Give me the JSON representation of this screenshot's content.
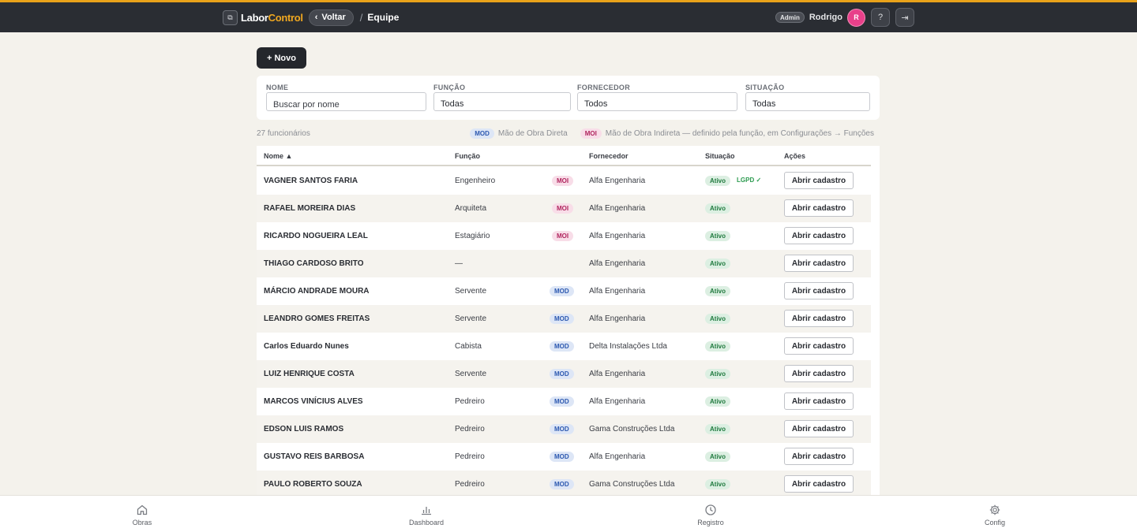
{
  "header": {
    "logo_glyph": "⧉",
    "brand_part1": "Labor",
    "brand_part2": "Control",
    "back_label": "Voltar",
    "back_icon": "‹",
    "separator": "/",
    "current_page": "Equipe",
    "role_badge": "Admin",
    "user_name": "Rodrigo",
    "avatar_initial": "R",
    "help_icon": "?",
    "logout_icon": "⇥"
  },
  "toolbar": {
    "new_label": "+ Novo"
  },
  "filters": {
    "name": {
      "label": "NOME",
      "placeholder": "Buscar por nome"
    },
    "function": {
      "label": "FUNÇÃO",
      "value": "Todas"
    },
    "supplier": {
      "label": "FORNECEDOR",
      "value": "Todos"
    },
    "status": {
      "label": "SITUAÇÃO",
      "value": "Todas"
    }
  },
  "summary": {
    "count": "27 funcionários",
    "mod_tag": "MOD",
    "mod_text": "Mão de Obra Direta",
    "moi_tag": "MOI",
    "moi_text": "Mão de Obra Indireta — definido pela função, em Configurações → Funções"
  },
  "table": {
    "columns": {
      "name": "Nome ▲",
      "function": "Função",
      "supplier": "Fornecedor",
      "status": "Situação",
      "actions": "Ações"
    },
    "action_label": "Abrir cadastro",
    "rows": [
      {
        "name": "VAGNER SANTOS FARIA",
        "function": "Engenheiro",
        "tag": "MOI",
        "supplier": "Alfa Engenharia",
        "status": "Ativo",
        "lgpd": "LGPD ✓"
      },
      {
        "name": "RAFAEL MOREIRA DIAS",
        "function": "Arquiteta",
        "tag": "MOI",
        "supplier": "Alfa Engenharia",
        "status": "Ativo",
        "lgpd": ""
      },
      {
        "name": "RICARDO NOGUEIRA LEAL",
        "function": "Estagiário",
        "tag": "MOI",
        "supplier": "Alfa Engenharia",
        "status": "Ativo",
        "lgpd": ""
      },
      {
        "name": "THIAGO CARDOSO BRITO",
        "function": "—",
        "tag": "",
        "supplier": "Alfa Engenharia",
        "status": "Ativo",
        "lgpd": ""
      },
      {
        "name": "MÁRCIO ANDRADE MOURA",
        "function": "Servente",
        "tag": "MOD",
        "supplier": "Alfa Engenharia",
        "status": "Ativo",
        "lgpd": ""
      },
      {
        "name": "LEANDRO GOMES FREITAS",
        "function": "Servente",
        "tag": "MOD",
        "supplier": "Alfa Engenharia",
        "status": "Ativo",
        "lgpd": ""
      },
      {
        "name": "Carlos Eduardo Nunes",
        "function": "Cabista",
        "tag": "MOD",
        "supplier": "Delta Instalações Ltda",
        "status": "Ativo",
        "lgpd": ""
      },
      {
        "name": "LUIZ HENRIQUE COSTA",
        "function": "Servente",
        "tag": "MOD",
        "supplier": "Alfa Engenharia",
        "status": "Ativo",
        "lgpd": ""
      },
      {
        "name": "MARCOS VINÍCIUS ALVES",
        "function": "Pedreiro",
        "tag": "MOD",
        "supplier": "Alfa Engenharia",
        "status": "Ativo",
        "lgpd": ""
      },
      {
        "name": "EDSON LUIS RAMOS",
        "function": "Pedreiro",
        "tag": "MOD",
        "supplier": "Gama Construções Ltda",
        "status": "Ativo",
        "lgpd": ""
      },
      {
        "name": "GUSTAVO REIS BARBOSA",
        "function": "Pedreiro",
        "tag": "MOD",
        "supplier": "Alfa Engenharia",
        "status": "Ativo",
        "lgpd": ""
      },
      {
        "name": "PAULO ROBERTO SOUZA",
        "function": "Pedreiro",
        "tag": "MOD",
        "supplier": "Gama Construções Ltda",
        "status": "Ativo",
        "lgpd": ""
      }
    ]
  },
  "bottom_nav": [
    {
      "label": "Obras",
      "icon": "home-icon"
    },
    {
      "label": "Dashboard",
      "icon": "bar-chart-icon"
    },
    {
      "label": "Registro",
      "icon": "clock-icon"
    },
    {
      "label": "Config",
      "icon": "gear-icon"
    }
  ],
  "colors": {
    "accent": "#e8a21a",
    "header_bg": "#2a2d33",
    "page_bg": "#f4f2ec",
    "mod_tag": "#2c58b0",
    "moi_tag": "#b0255e",
    "status_active": "#1f7a3e",
    "avatar": "#e8408a"
  }
}
